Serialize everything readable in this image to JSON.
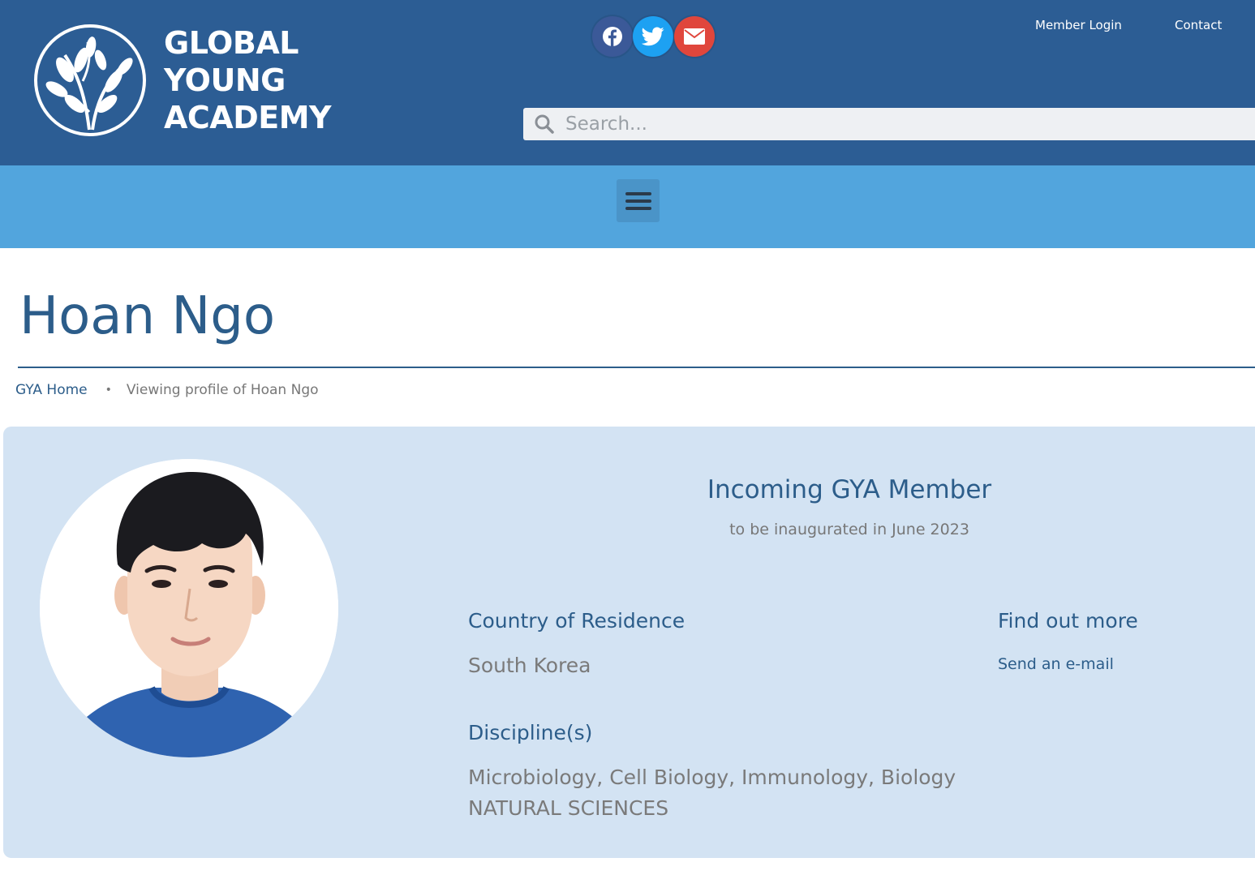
{
  "header": {
    "logo": {
      "line1": "GLOBAL",
      "line2": "YOUNG",
      "line3": "ACADEMY"
    },
    "social": [
      {
        "name": "facebook-icon",
        "color": "#3b5998"
      },
      {
        "name": "twitter-icon",
        "color": "#1da1f2"
      },
      {
        "name": "email-icon",
        "color": "#e0463c"
      }
    ],
    "links": {
      "member_login": "Member Login",
      "contact": "Contact"
    },
    "search": {
      "placeholder": "Search..."
    },
    "colors": {
      "header_bg": "#2c5d94",
      "nav_bg": "#52a5dd"
    }
  },
  "nav": {
    "menu_icon": "hamburger-menu-icon"
  },
  "page": {
    "title": "Hoan Ngo",
    "breadcrumb": {
      "home": "GYA Home",
      "separator": "•",
      "current": "Viewing profile of Hoan Ngo"
    }
  },
  "profile": {
    "status_heading": "Incoming GYA Member",
    "status_sub": "to be inaugurated in June 2023",
    "country_label": "Country of Residence",
    "country_value": "South Korea",
    "discipline_label": "Discipline(s)",
    "discipline_value": "Microbiology, Cell Biology, Immunology, Biology",
    "field_value": "NATURAL SCIENCES",
    "find_out_label": "Find out more",
    "email_link": "Send an e-mail",
    "card_bg": "#d3e3f3",
    "accent": "#2c5d8a"
  }
}
